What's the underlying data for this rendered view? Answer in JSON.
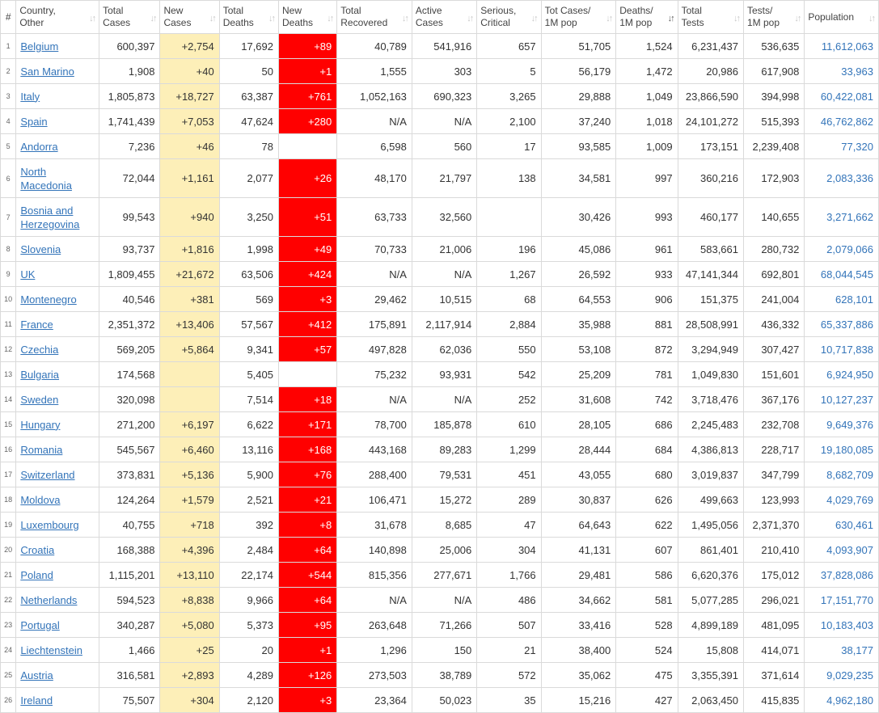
{
  "headers": [
    {
      "name": "#",
      "line1": "#",
      "line2": ""
    },
    {
      "name": "country",
      "line1": "Country,",
      "line2": "Other"
    },
    {
      "name": "total-cases",
      "line1": "Total",
      "line2": "Cases"
    },
    {
      "name": "new-cases",
      "line1": "New",
      "line2": "Cases"
    },
    {
      "name": "total-deaths",
      "line1": "Total",
      "line2": "Deaths"
    },
    {
      "name": "new-deaths",
      "line1": "New",
      "line2": "Deaths"
    },
    {
      "name": "total-recovered",
      "line1": "Total",
      "line2": "Recovered"
    },
    {
      "name": "active-cases",
      "line1": "Active",
      "line2": "Cases"
    },
    {
      "name": "serious-critical",
      "line1": "Serious,",
      "line2": "Critical"
    },
    {
      "name": "tot-cases-1m",
      "line1": "Tot Cases/",
      "line2": "1M pop"
    },
    {
      "name": "deaths-1m",
      "line1": "Deaths/",
      "line2": "1M pop"
    },
    {
      "name": "total-tests",
      "line1": "Total",
      "line2": "Tests"
    },
    {
      "name": "tests-1m",
      "line1": "Tests/",
      "line2": "1M pop"
    },
    {
      "name": "population",
      "line1": "Population",
      "line2": ""
    }
  ],
  "sort_column": "deaths-1m",
  "rows": [
    {
      "idx": "1",
      "country": "Belgium",
      "total_cases": "600,397",
      "new_cases": "+2,754",
      "total_deaths": "17,692",
      "new_deaths": "+89",
      "total_recovered": "40,789",
      "active_cases": "541,916",
      "serious": "657",
      "cases_1m": "51,705",
      "deaths_1m": "1,524",
      "total_tests": "6,231,437",
      "tests_1m": "536,635",
      "population": "11,612,063"
    },
    {
      "idx": "2",
      "country": "San Marino",
      "total_cases": "1,908",
      "new_cases": "+40",
      "total_deaths": "50",
      "new_deaths": "+1",
      "total_recovered": "1,555",
      "active_cases": "303",
      "serious": "5",
      "cases_1m": "56,179",
      "deaths_1m": "1,472",
      "total_tests": "20,986",
      "tests_1m": "617,908",
      "population": "33,963"
    },
    {
      "idx": "3",
      "country": "Italy",
      "total_cases": "1,805,873",
      "new_cases": "+18,727",
      "total_deaths": "63,387",
      "new_deaths": "+761",
      "total_recovered": "1,052,163",
      "active_cases": "690,323",
      "serious": "3,265",
      "cases_1m": "29,888",
      "deaths_1m": "1,049",
      "total_tests": "23,866,590",
      "tests_1m": "394,998",
      "population": "60,422,081"
    },
    {
      "idx": "4",
      "country": "Spain",
      "total_cases": "1,741,439",
      "new_cases": "+7,053",
      "total_deaths": "47,624",
      "new_deaths": "+280",
      "total_recovered": "N/A",
      "active_cases": "N/A",
      "serious": "2,100",
      "cases_1m": "37,240",
      "deaths_1m": "1,018",
      "total_tests": "24,101,272",
      "tests_1m": "515,393",
      "population": "46,762,862"
    },
    {
      "idx": "5",
      "country": "Andorra",
      "total_cases": "7,236",
      "new_cases": "+46",
      "total_deaths": "78",
      "new_deaths": "",
      "total_recovered": "6,598",
      "active_cases": "560",
      "serious": "17",
      "cases_1m": "93,585",
      "deaths_1m": "1,009",
      "total_tests": "173,151",
      "tests_1m": "2,239,408",
      "population": "77,320"
    },
    {
      "idx": "6",
      "country": "North Macedonia",
      "total_cases": "72,044",
      "new_cases": "+1,161",
      "total_deaths": "2,077",
      "new_deaths": "+26",
      "total_recovered": "48,170",
      "active_cases": "21,797",
      "serious": "138",
      "cases_1m": "34,581",
      "deaths_1m": "997",
      "total_tests": "360,216",
      "tests_1m": "172,903",
      "population": "2,083,336",
      "tall": true
    },
    {
      "idx": "7",
      "country": "Bosnia and Herzegovina",
      "total_cases": "99,543",
      "new_cases": "+940",
      "total_deaths": "3,250",
      "new_deaths": "+51",
      "total_recovered": "63,733",
      "active_cases": "32,560",
      "serious": "",
      "cases_1m": "30,426",
      "deaths_1m": "993",
      "total_tests": "460,177",
      "tests_1m": "140,655",
      "population": "3,271,662",
      "tall": true
    },
    {
      "idx": "8",
      "country": "Slovenia",
      "total_cases": "93,737",
      "new_cases": "+1,816",
      "total_deaths": "1,998",
      "new_deaths": "+49",
      "total_recovered": "70,733",
      "active_cases": "21,006",
      "serious": "196",
      "cases_1m": "45,086",
      "deaths_1m": "961",
      "total_tests": "583,661",
      "tests_1m": "280,732",
      "population": "2,079,066"
    },
    {
      "idx": "9",
      "country": "UK",
      "total_cases": "1,809,455",
      "new_cases": "+21,672",
      "total_deaths": "63,506",
      "new_deaths": "+424",
      "total_recovered": "N/A",
      "active_cases": "N/A",
      "serious": "1,267",
      "cases_1m": "26,592",
      "deaths_1m": "933",
      "total_tests": "47,141,344",
      "tests_1m": "692,801",
      "population": "68,044,545"
    },
    {
      "idx": "10",
      "country": "Montenegro",
      "total_cases": "40,546",
      "new_cases": "+381",
      "total_deaths": "569",
      "new_deaths": "+3",
      "total_recovered": "29,462",
      "active_cases": "10,515",
      "serious": "68",
      "cases_1m": "64,553",
      "deaths_1m": "906",
      "total_tests": "151,375",
      "tests_1m": "241,004",
      "population": "628,101"
    },
    {
      "idx": "11",
      "country": "France",
      "total_cases": "2,351,372",
      "new_cases": "+13,406",
      "total_deaths": "57,567",
      "new_deaths": "+412",
      "total_recovered": "175,891",
      "active_cases": "2,117,914",
      "serious": "2,884",
      "cases_1m": "35,988",
      "deaths_1m": "881",
      "total_tests": "28,508,991",
      "tests_1m": "436,332",
      "population": "65,337,886"
    },
    {
      "idx": "12",
      "country": "Czechia",
      "total_cases": "569,205",
      "new_cases": "+5,864",
      "total_deaths": "9,341",
      "new_deaths": "+57",
      "total_recovered": "497,828",
      "active_cases": "62,036",
      "serious": "550",
      "cases_1m": "53,108",
      "deaths_1m": "872",
      "total_tests": "3,294,949",
      "tests_1m": "307,427",
      "population": "10,717,838"
    },
    {
      "idx": "13",
      "country": "Bulgaria",
      "total_cases": "174,568",
      "new_cases": "",
      "total_deaths": "5,405",
      "new_deaths": "",
      "total_recovered": "75,232",
      "active_cases": "93,931",
      "serious": "542",
      "cases_1m": "25,209",
      "deaths_1m": "781",
      "total_tests": "1,049,830",
      "tests_1m": "151,601",
      "population": "6,924,950"
    },
    {
      "idx": "14",
      "country": "Sweden",
      "total_cases": "320,098",
      "new_cases": "",
      "total_deaths": "7,514",
      "new_deaths": "+18",
      "total_recovered": "N/A",
      "active_cases": "N/A",
      "serious": "252",
      "cases_1m": "31,608",
      "deaths_1m": "742",
      "total_tests": "3,718,476",
      "tests_1m": "367,176",
      "population": "10,127,237"
    },
    {
      "idx": "15",
      "country": "Hungary",
      "total_cases": "271,200",
      "new_cases": "+6,197",
      "total_deaths": "6,622",
      "new_deaths": "+171",
      "total_recovered": "78,700",
      "active_cases": "185,878",
      "serious": "610",
      "cases_1m": "28,105",
      "deaths_1m": "686",
      "total_tests": "2,245,483",
      "tests_1m": "232,708",
      "population": "9,649,376"
    },
    {
      "idx": "16",
      "country": "Romania",
      "total_cases": "545,567",
      "new_cases": "+6,460",
      "total_deaths": "13,116",
      "new_deaths": "+168",
      "total_recovered": "443,168",
      "active_cases": "89,283",
      "serious": "1,299",
      "cases_1m": "28,444",
      "deaths_1m": "684",
      "total_tests": "4,386,813",
      "tests_1m": "228,717",
      "population": "19,180,085"
    },
    {
      "idx": "17",
      "country": "Switzerland",
      "total_cases": "373,831",
      "new_cases": "+5,136",
      "total_deaths": "5,900",
      "new_deaths": "+76",
      "total_recovered": "288,400",
      "active_cases": "79,531",
      "serious": "451",
      "cases_1m": "43,055",
      "deaths_1m": "680",
      "total_tests": "3,019,837",
      "tests_1m": "347,799",
      "population": "8,682,709"
    },
    {
      "idx": "18",
      "country": "Moldova",
      "total_cases": "124,264",
      "new_cases": "+1,579",
      "total_deaths": "2,521",
      "new_deaths": "+21",
      "total_recovered": "106,471",
      "active_cases": "15,272",
      "serious": "289",
      "cases_1m": "30,837",
      "deaths_1m": "626",
      "total_tests": "499,663",
      "tests_1m": "123,993",
      "population": "4,029,769"
    },
    {
      "idx": "19",
      "country": "Luxembourg",
      "total_cases": "40,755",
      "new_cases": "+718",
      "total_deaths": "392",
      "new_deaths": "+8",
      "total_recovered": "31,678",
      "active_cases": "8,685",
      "serious": "47",
      "cases_1m": "64,643",
      "deaths_1m": "622",
      "total_tests": "1,495,056",
      "tests_1m": "2,371,370",
      "population": "630,461"
    },
    {
      "idx": "20",
      "country": "Croatia",
      "total_cases": "168,388",
      "new_cases": "+4,396",
      "total_deaths": "2,484",
      "new_deaths": "+64",
      "total_recovered": "140,898",
      "active_cases": "25,006",
      "serious": "304",
      "cases_1m": "41,131",
      "deaths_1m": "607",
      "total_tests": "861,401",
      "tests_1m": "210,410",
      "population": "4,093,907"
    },
    {
      "idx": "21",
      "country": "Poland",
      "total_cases": "1,115,201",
      "new_cases": "+13,110",
      "total_deaths": "22,174",
      "new_deaths": "+544",
      "total_recovered": "815,356",
      "active_cases": "277,671",
      "serious": "1,766",
      "cases_1m": "29,481",
      "deaths_1m": "586",
      "total_tests": "6,620,376",
      "tests_1m": "175,012",
      "population": "37,828,086"
    },
    {
      "idx": "22",
      "country": "Netherlands",
      "total_cases": "594,523",
      "new_cases": "+8,838",
      "total_deaths": "9,966",
      "new_deaths": "+64",
      "total_recovered": "N/A",
      "active_cases": "N/A",
      "serious": "486",
      "cases_1m": "34,662",
      "deaths_1m": "581",
      "total_tests": "5,077,285",
      "tests_1m": "296,021",
      "population": "17,151,770"
    },
    {
      "idx": "23",
      "country": "Portugal",
      "total_cases": "340,287",
      "new_cases": "+5,080",
      "total_deaths": "5,373",
      "new_deaths": "+95",
      "total_recovered": "263,648",
      "active_cases": "71,266",
      "serious": "507",
      "cases_1m": "33,416",
      "deaths_1m": "528",
      "total_tests": "4,899,189",
      "tests_1m": "481,095",
      "population": "10,183,403"
    },
    {
      "idx": "24",
      "country": "Liechtenstein",
      "total_cases": "1,466",
      "new_cases": "+25",
      "total_deaths": "20",
      "new_deaths": "+1",
      "total_recovered": "1,296",
      "active_cases": "150",
      "serious": "21",
      "cases_1m": "38,400",
      "deaths_1m": "524",
      "total_tests": "15,808",
      "tests_1m": "414,071",
      "population": "38,177"
    },
    {
      "idx": "25",
      "country": "Austria",
      "total_cases": "316,581",
      "new_cases": "+2,893",
      "total_deaths": "4,289",
      "new_deaths": "+126",
      "total_recovered": "273,503",
      "active_cases": "38,789",
      "serious": "572",
      "cases_1m": "35,062",
      "deaths_1m": "475",
      "total_tests": "3,355,391",
      "tests_1m": "371,614",
      "population": "9,029,235"
    },
    {
      "idx": "26",
      "country": "Ireland",
      "total_cases": "75,507",
      "new_cases": "+304",
      "total_deaths": "2,120",
      "new_deaths": "+3",
      "total_recovered": "23,364",
      "active_cases": "50,023",
      "serious": "35",
      "cases_1m": "15,216",
      "deaths_1m": "427",
      "total_tests": "2,063,450",
      "tests_1m": "415,835",
      "population": "4,962,180"
    }
  ]
}
